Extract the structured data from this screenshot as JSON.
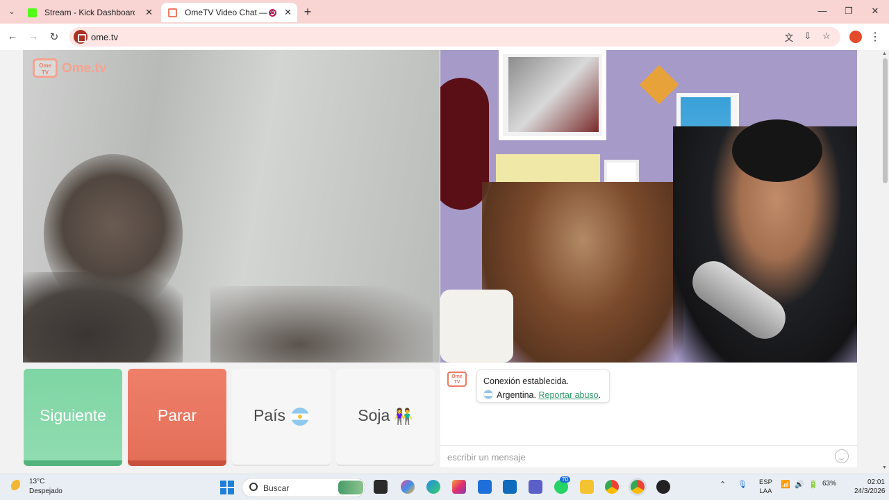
{
  "browser": {
    "tabs": [
      {
        "title": "Stream - Kick Dashboard",
        "favicon_color": "#53fc18",
        "active": false
      },
      {
        "title": "OmeTV Video Chat — Alte",
        "favicon_color": "#ef7a62",
        "active": true
      }
    ],
    "new_tab": "+",
    "url": "ome.tv",
    "window_controls": {
      "minimize": "—",
      "maximize": "❐",
      "close": "✕"
    }
  },
  "page": {
    "logo_tv": "Ome TV",
    "logo_text": "Ome.tv",
    "buttons": {
      "next": "Siguiente",
      "stop": "Parar",
      "country": "País",
      "gender": "Soja"
    },
    "chat": {
      "avatar": "Ome TV",
      "messages": [
        {
          "line1": "Conexión establecida.",
          "country": "Argentina",
          "report_link": "Reportar abuso"
        }
      ],
      "input_placeholder": "escribir un mensaje"
    }
  },
  "taskbar": {
    "weather_temp": "13°C",
    "weather_desc": "Despejado",
    "search_label": "Buscar",
    "teams_badge": "70",
    "battery": "63%",
    "lang_line1": "ESP",
    "lang_line2": "LAA",
    "time": "02:01",
    "date": "24/3/2026"
  },
  "colors": {
    "accent_green": "#7fd5a4",
    "accent_red": "#e46f59",
    "link_green": "#2e9c6a",
    "tab_strip": "#f8d5d3"
  }
}
